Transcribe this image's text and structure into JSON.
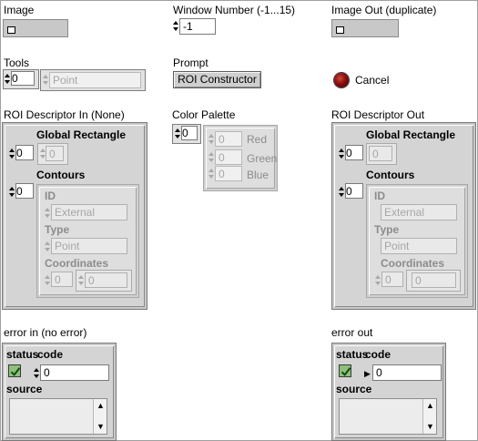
{
  "controls": {
    "image": {
      "label": "Image"
    },
    "window_number": {
      "label": "Window Number (-1...15)",
      "value": "-1"
    },
    "image_out": {
      "label": "Image Out (duplicate)"
    },
    "tools": {
      "label": "Tools",
      "index": "0",
      "value": "Point"
    },
    "prompt": {
      "label": "Prompt",
      "button": "ROI Constructor"
    },
    "cancel": {
      "label": "Cancel",
      "led_color": "#8a0d0d"
    },
    "roi_in": {
      "label": "ROI Descriptor In (None)",
      "global_rect": {
        "label": "Global Rectangle",
        "index": "0",
        "value": "0"
      },
      "contours": {
        "label": "Contours",
        "index": "0",
        "id_label": "ID",
        "id_value": "External",
        "type_label": "Type",
        "type_value": "Point",
        "coords_label": "Coordinates",
        "coords_index": "0",
        "coords_value": "0"
      }
    },
    "color_palette": {
      "label": "Color Palette",
      "index": "0",
      "red_value": "0",
      "red_label": "Red",
      "green_value": "0",
      "green_label": "Green",
      "blue_value": "0",
      "blue_label": "Blue"
    },
    "roi_out": {
      "label": "ROI Descriptor Out",
      "global_rect": {
        "label": "Global Rectangle",
        "index": "0",
        "value": "0"
      },
      "contours": {
        "label": "Contours",
        "index": "0",
        "id_label": "ID",
        "id_value": "External",
        "type_label": "Type",
        "type_value": "Point",
        "coords_label": "Coordinates",
        "coords_index": "0",
        "coords_value": "0"
      }
    },
    "error_in": {
      "label": "error in (no error)",
      "status_label": "status",
      "code_label": "code",
      "code_value": "0",
      "source_label": "source"
    },
    "error_out": {
      "label": "error out",
      "status_label": "status",
      "code_label": "code",
      "code_value": "0",
      "source_label": "source"
    }
  },
  "colors": {
    "panel": "#ffffff",
    "cluster": "#d4d4d4",
    "status_check": "#8fbf7b"
  }
}
